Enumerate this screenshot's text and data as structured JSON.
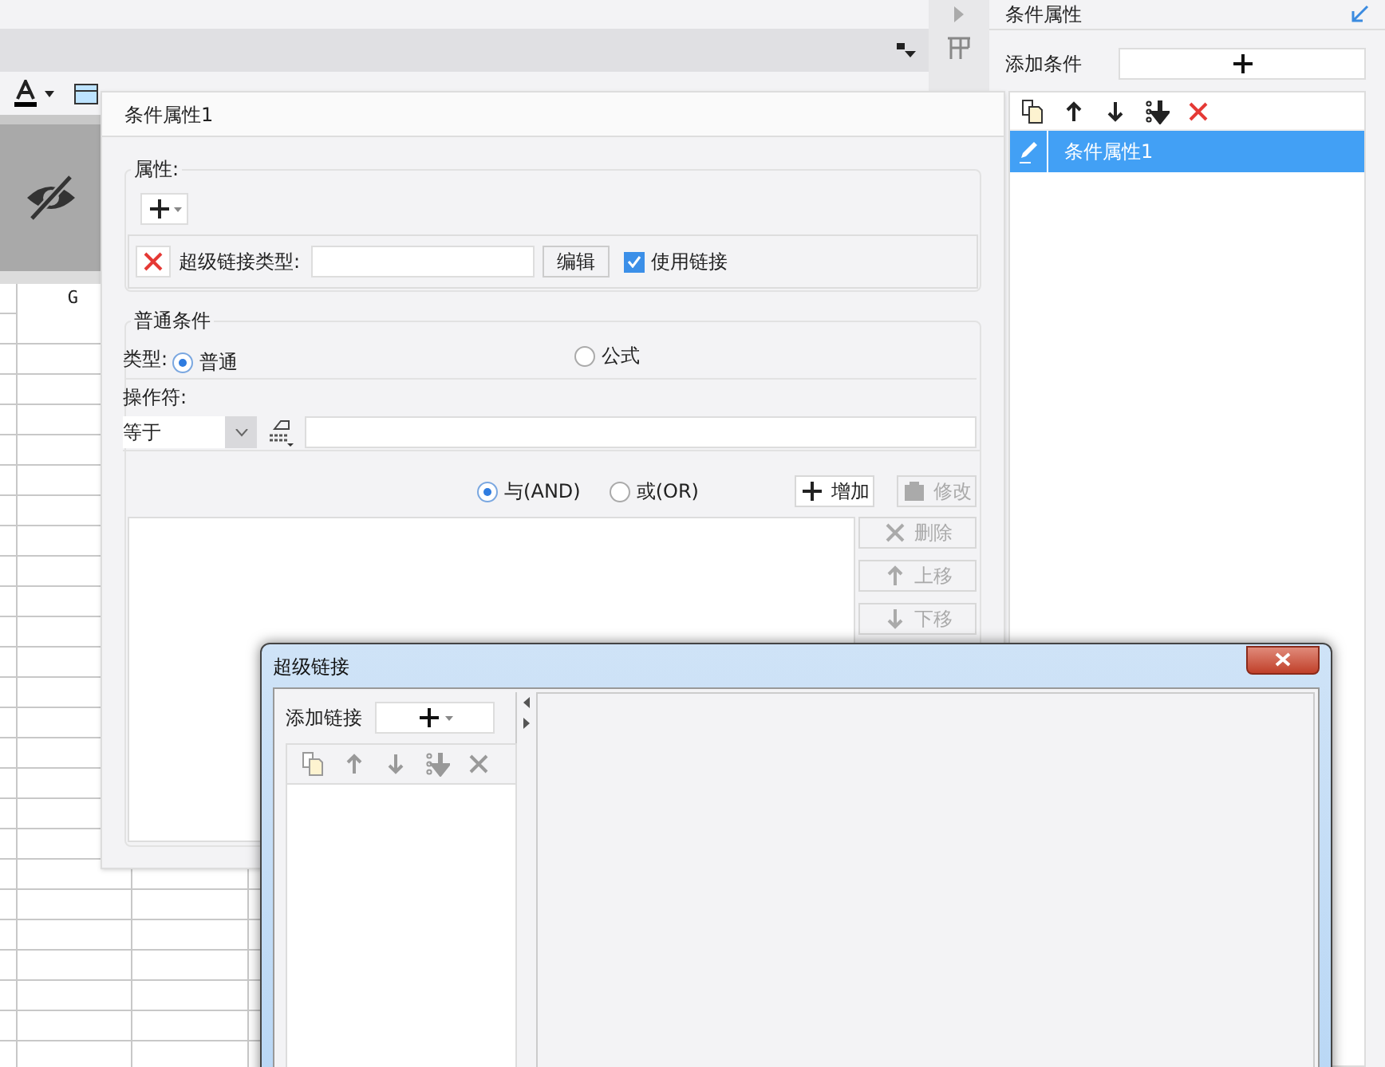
{
  "sheet": {
    "column_header": "G"
  },
  "side_panel": {
    "title": "条件属性",
    "add_label": "添加条件",
    "conditions": [
      {
        "label": "条件属性1",
        "selected": true
      }
    ]
  },
  "condition_dialog": {
    "title": "条件属性1",
    "attributes_legend": "属性:",
    "hyperlink_type_label": "超级链接类型:",
    "edit_button": "编辑",
    "use_link": {
      "label": "使用链接",
      "checked": true
    },
    "general_legend": "普通条件",
    "type_label": "类型:",
    "type_options": [
      {
        "label": "普通",
        "selected": true
      },
      {
        "label": "公式",
        "selected": false
      }
    ],
    "operator_label": "操作符:",
    "operator_value": "等于",
    "logic_options": [
      {
        "label": "与(AND)",
        "selected": true
      },
      {
        "label": "或(OR)",
        "selected": false
      }
    ],
    "buttons": [
      {
        "kind": "add",
        "label": "增加",
        "disabled": false
      },
      {
        "kind": "edit",
        "label": "修改",
        "disabled": true
      },
      {
        "kind": "delete",
        "label": "删除",
        "disabled": true
      },
      {
        "kind": "up",
        "label": "上移",
        "disabled": true
      },
      {
        "kind": "down",
        "label": "下移",
        "disabled": true
      }
    ]
  },
  "hyperlink_dialog": {
    "title": "超级链接",
    "add_label": "添加链接"
  }
}
